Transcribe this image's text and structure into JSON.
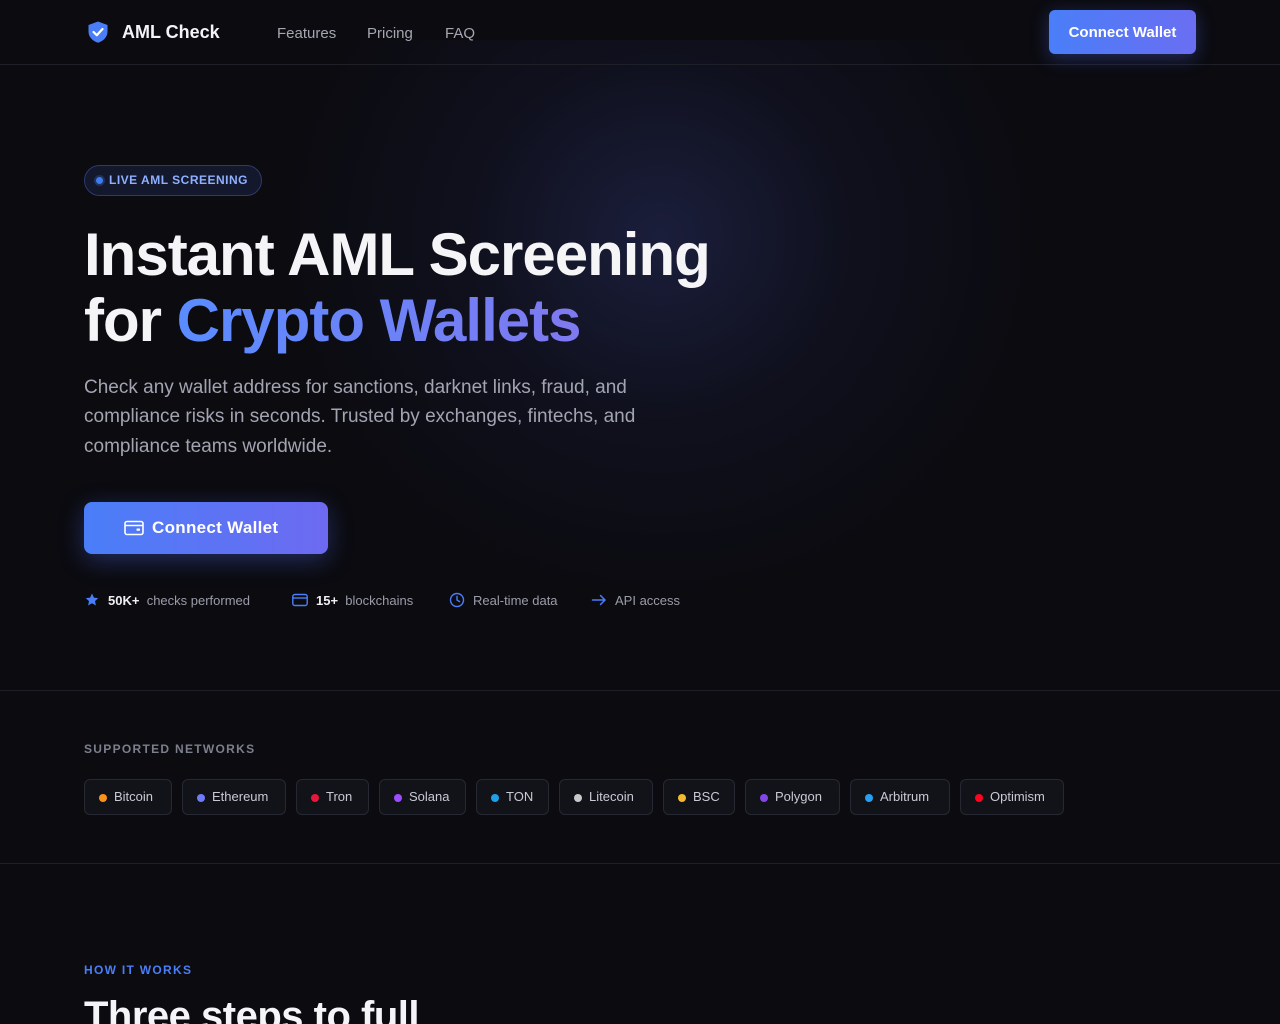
{
  "header": {
    "brand": "AML Check",
    "nav": [
      "Features",
      "Pricing",
      "FAQ"
    ],
    "connect_label": "Connect Wallet"
  },
  "hero": {
    "badge": "LIVE AML SCREENING",
    "title_line1": "Instant AML Screening",
    "title_line2_prefix": "for ",
    "title_line2_highlight": "Crypto Wallets",
    "lead_line1": "Check any wallet address for sanctions, darknet links, fraud, and",
    "lead_line2": "compliance risks in seconds. Trusted by exchanges, fintechs, and",
    "lead_line3": "compliance teams worldwide.",
    "cta_label": "Connect Wallet",
    "stats": {
      "checks": {
        "value": "50K+",
        "label": "checks performed"
      },
      "chains": {
        "value": "15+",
        "label": "blockchains"
      },
      "realtime": {
        "label": "Real-time data"
      },
      "api": {
        "label": "API access"
      }
    }
  },
  "networks": {
    "label": "SUPPORTED NETWORKS",
    "items": [
      {
        "name": "Bitcoin",
        "color": "#f7931a"
      },
      {
        "name": "Ethereum",
        "color": "#6f7cf5"
      },
      {
        "name": "Tron",
        "color": "#e5183c"
      },
      {
        "name": "Solana",
        "color": "#9b4dff"
      },
      {
        "name": "TON",
        "color": "#1e9fe8"
      },
      {
        "name": "Litecoin",
        "color": "#c8c8c8"
      },
      {
        "name": "BSC",
        "color": "#f3ba2f"
      },
      {
        "name": "Polygon",
        "color": "#8247e5"
      },
      {
        "name": "Arbitrum",
        "color": "#28a0f0"
      },
      {
        "name": "Optimism",
        "color": "#ff0420"
      }
    ]
  },
  "how": {
    "label": "HOW IT WORKS",
    "title": "Three steps to full"
  },
  "colors": {
    "accent": "#4a7ef8",
    "accent2": "#6a6ef2",
    "background": "#0b0b10"
  }
}
